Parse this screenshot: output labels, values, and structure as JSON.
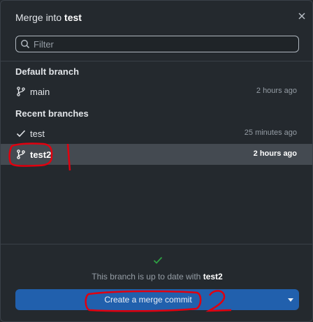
{
  "header": {
    "title_prefix": "Merge into",
    "title_branch": "test",
    "close_icon": "close-icon"
  },
  "filter": {
    "placeholder": "Filter",
    "value": ""
  },
  "default_branch": {
    "title": "Default branch",
    "items": [
      {
        "name": "main",
        "time": "2 hours ago",
        "icon": "git-branch-icon"
      }
    ]
  },
  "recent_branches": {
    "title": "Recent branches",
    "items": [
      {
        "name": "test",
        "time": "25 minutes ago",
        "icon": "check-icon"
      },
      {
        "name": "test2",
        "time": "2 hours ago",
        "icon": "git-branch-icon",
        "selected": true
      }
    ]
  },
  "footer": {
    "status_prefix": "This branch is up to date with",
    "status_branch": "test2",
    "merge_button": "Create a merge commit",
    "status_color": "#2ea043"
  },
  "annotations": {
    "label_1": "1",
    "label_2": "2",
    "color": "#e0000f"
  },
  "colors": {
    "accent": "#2160ad",
    "selected_row": "#444a51",
    "background": "#24292e"
  }
}
